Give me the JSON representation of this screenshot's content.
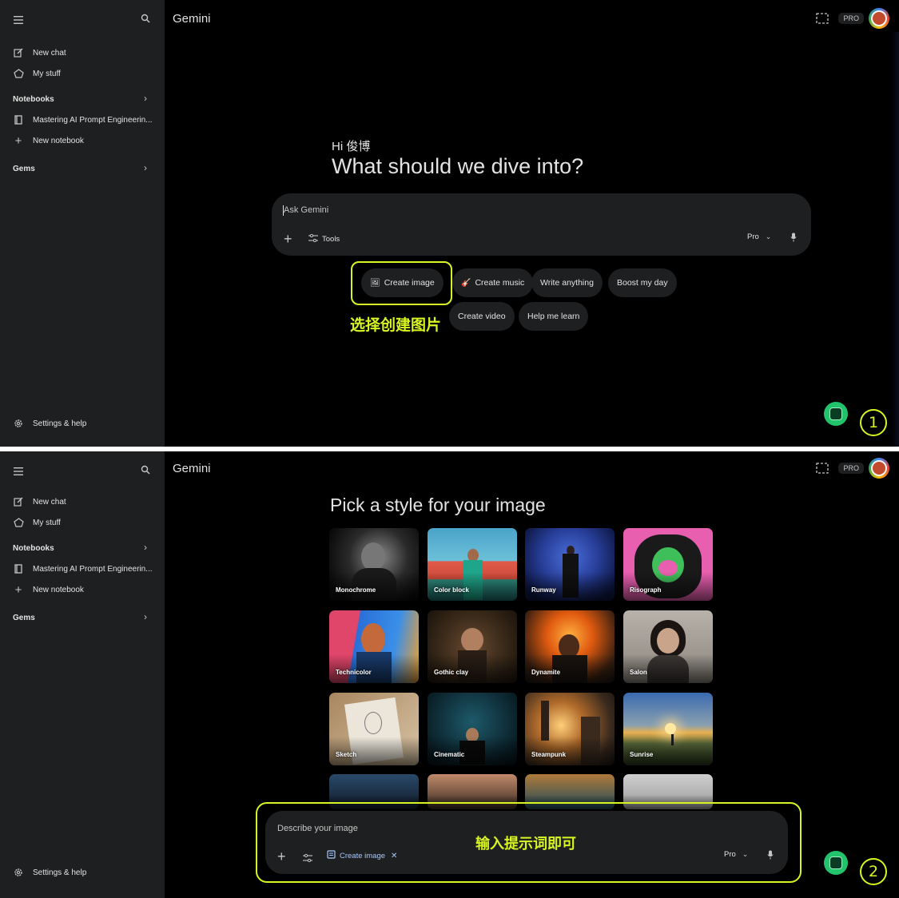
{
  "app": {
    "title": "Gemini",
    "pro_badge": "PRO"
  },
  "sidebar": {
    "new_chat": "New chat",
    "my_stuff": "My stuff",
    "notebooks_header": "Notebooks",
    "notebook_item": "Mastering AI Prompt Engineerin...",
    "new_notebook": "New notebook",
    "gems_header": "Gems",
    "settings": "Settings & help"
  },
  "screen1": {
    "greeting_hi": "Hi 俊博",
    "greeting_question": "What should we dive into?",
    "prompt_placeholder": "Ask Gemini",
    "tools_label": "Tools",
    "model_label": "Pro",
    "chips": [
      "Create image",
      "Create music",
      "Write anything",
      "Boost my day",
      "Create video",
      "Help me learn"
    ],
    "annotation": "选择创建图片",
    "step": "1"
  },
  "screen2": {
    "styles_title": "Pick a style for your image",
    "styles": [
      "Monochrome",
      "Color block",
      "Runway",
      "Risograph",
      "Technicolor",
      "Gothic clay",
      "Dynamite",
      "Salon",
      "Sketch",
      "Cinematic",
      "Steampunk",
      "Sunrise"
    ],
    "describe_placeholder": "Describe your image",
    "create_image_chip": "Create image",
    "model_label": "Pro",
    "annotation": "输入提示词即可",
    "step": "2"
  },
  "colors": {
    "accent_annotation": "#d8f522",
    "background": "#000000",
    "sidebar": "#1e1f20",
    "link_blue": "#a8c7fa"
  },
  "icons": [
    "menu-icon",
    "search-icon",
    "edit-icon",
    "stuff-icon",
    "notebook-icon",
    "plus-icon",
    "chevron-right-icon",
    "gear-icon",
    "share-screen-icon",
    "tools-icon",
    "chevron-down-icon",
    "mic-icon",
    "close-icon",
    "create-image-icon"
  ]
}
